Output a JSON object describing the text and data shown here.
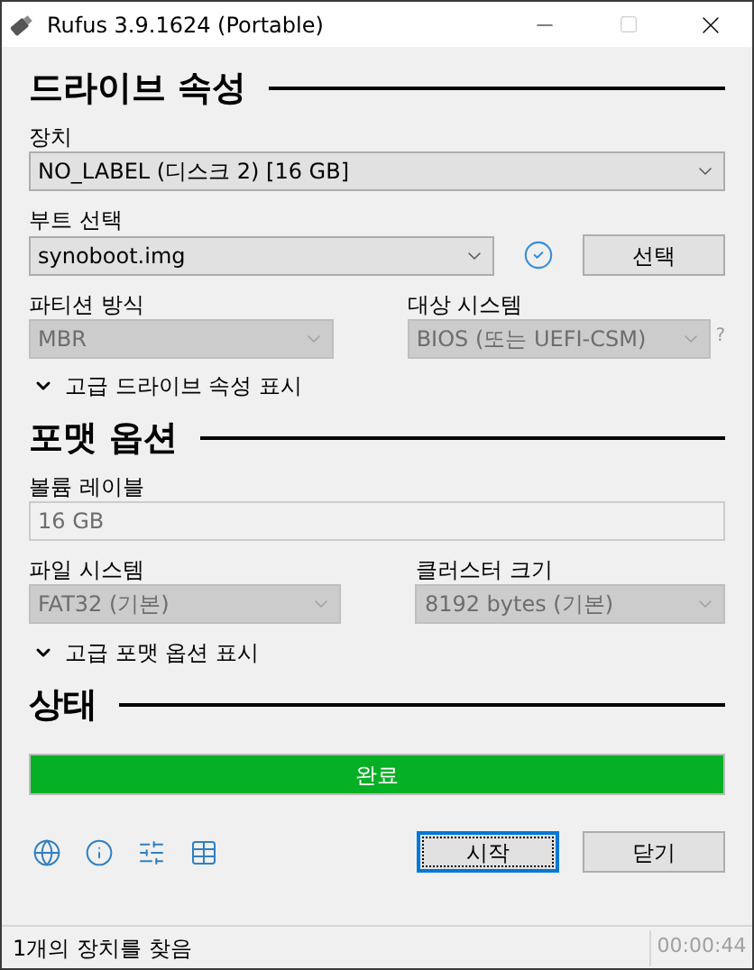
{
  "window": {
    "title": "Rufus 3.9.1624 (Portable)"
  },
  "drive_properties": {
    "heading": "드라이브 속성",
    "device": {
      "label": "장치",
      "value": "NO_LABEL (디스크 2) [16 GB]",
      "disabled": false
    },
    "boot_selection": {
      "label": "부트 선택",
      "value": "synoboot.img",
      "disabled": false,
      "verified": true,
      "button": "선택"
    },
    "partition_scheme": {
      "label": "파티션 방식",
      "value": "MBR",
      "disabled": true
    },
    "target_system": {
      "label": "대상 시스템",
      "value": "BIOS (또는 UEFI-CSM)",
      "disabled": true,
      "help": "?"
    },
    "advanced_toggle": {
      "label": "고급 드라이브 속성 표시",
      "expanded": false
    }
  },
  "format_options": {
    "heading": "포맷 옵션",
    "volume_label": {
      "label": "볼륨 레이블",
      "value": "16 GB",
      "disabled": true
    },
    "file_system": {
      "label": "파일 시스템",
      "value": "FAT32 (기본)",
      "disabled": true
    },
    "cluster_size": {
      "label": "클러스터 크기",
      "value": "8192 bytes (기본)",
      "disabled": true
    },
    "advanced_toggle": {
      "label": "고급 포맷 옵션 표시",
      "expanded": false
    }
  },
  "status": {
    "heading": "상태",
    "progress": {
      "text": "완료",
      "level": 1
    }
  },
  "buttons": [
    {
      "label": "시작",
      "focused": true
    },
    {
      "label": "닫기",
      "focused": false
    }
  ],
  "status_bar": {
    "message": "1개의 장치를 찾음",
    "time": "00:00:44"
  }
}
